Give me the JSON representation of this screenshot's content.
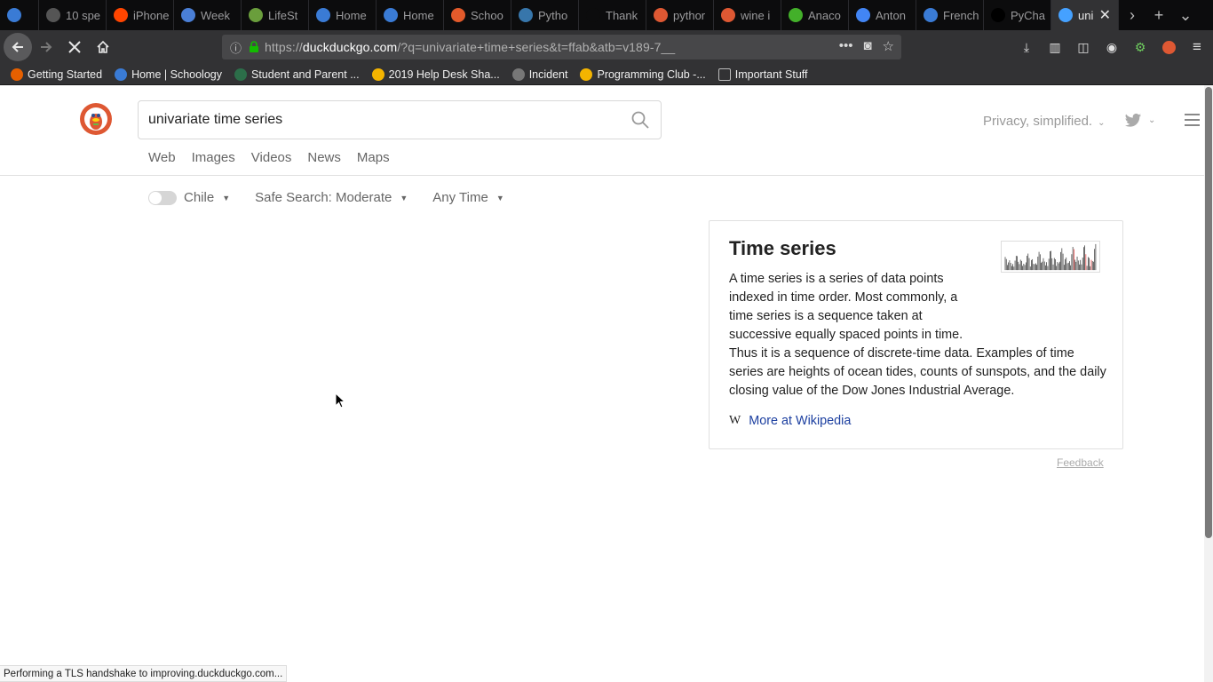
{
  "browser": {
    "tabs": [
      {
        "label": "",
        "icon": "schoology-icon",
        "color": "#3a7bd5"
      },
      {
        "label": "10 spe",
        "icon": "site-icon",
        "color": "#555"
      },
      {
        "label": "iPhone",
        "icon": "reddit-icon",
        "color": "#ff4500"
      },
      {
        "label": "Week",
        "icon": "infinity-icon",
        "color": "#4a7fd6"
      },
      {
        "label": "LifeSt",
        "icon": "image-icon",
        "color": "#6a9e3c"
      },
      {
        "label": "Home",
        "icon": "schoology-icon",
        "color": "#3a7bd5"
      },
      {
        "label": "Home",
        "icon": "schoology-icon",
        "color": "#3a7bd5"
      },
      {
        "label": "Schoo",
        "icon": "loading-icon",
        "color": "#e25a2b"
      },
      {
        "label": "Pytho",
        "icon": "python-icon",
        "color": "#3776ab"
      },
      {
        "label": "Thank",
        "icon": "blank-icon",
        "color": "#0c0c0d"
      },
      {
        "label": "pythor",
        "icon": "ddg-icon",
        "color": "#de5833"
      },
      {
        "label": "wine i",
        "icon": "ddg-icon",
        "color": "#de5833"
      },
      {
        "label": "Anaco",
        "icon": "anaconda-icon",
        "color": "#43b02a"
      },
      {
        "label": "Anton",
        "icon": "docs-icon",
        "color": "#4285f4"
      },
      {
        "label": "French",
        "icon": "schoology-icon",
        "color": "#3a7bd5"
      },
      {
        "label": "PyCha",
        "icon": "pycharm-icon",
        "color": "#000"
      },
      {
        "label": "uni",
        "icon": "loading-dot-icon",
        "color": "#45a1ff",
        "active": true
      }
    ],
    "url": {
      "prefix": "https://",
      "host": "duckduckgo.com",
      "rest": "/?q=univariate+time+series&t=ffab&atb=v189-7__"
    },
    "bookmarks": [
      {
        "label": "Getting Started",
        "icon": "firefox-icon",
        "color": "#e66000"
      },
      {
        "label": "Home | Schoology",
        "icon": "schoology-icon",
        "color": "#3a7bd5"
      },
      {
        "label": "Student and Parent ...",
        "icon": "p-icon",
        "color": "#2c6e49"
      },
      {
        "label": "2019 Help Desk Sha...",
        "icon": "drive-icon",
        "color": "#f4b400"
      },
      {
        "label": "Incident",
        "icon": "globe-icon",
        "color": "#777"
      },
      {
        "label": "Programming Club -...",
        "icon": "drive-icon",
        "color": "#f4b400"
      },
      {
        "label": "Important Stuff",
        "icon": "folder-icon",
        "color": "#bbb"
      }
    ],
    "status_text": "Performing a TLS handshake to improving.duckduckgo.com..."
  },
  "search": {
    "query": "univariate time series",
    "tabs": [
      "Web",
      "Images",
      "Videos",
      "News",
      "Maps"
    ],
    "privacy_label": "Privacy, simplified.",
    "filters": {
      "region": "Chile",
      "safe_search": "Safe Search: Moderate",
      "time": "Any Time"
    }
  },
  "knowledge_panel": {
    "title": "Time series",
    "text_first": "A time series is a series of data points indexed in time order. Most commonly, a time series is a sequence taken at successive equally spaced points in time.",
    "text_rest": "Thus it is a sequence of discrete-time data. Examples of time series are heights of ocean tides, counts of sunspots, and the daily closing value of the Dow Jones Industrial Average.",
    "link_label": "More at Wikipedia",
    "feedback_label": "Feedback"
  },
  "colors": {
    "ddg_orange": "#de5833",
    "link_blue": "#1c3fa0",
    "chrome_dark": "#0c0c0d",
    "chrome_mid": "#323234"
  }
}
